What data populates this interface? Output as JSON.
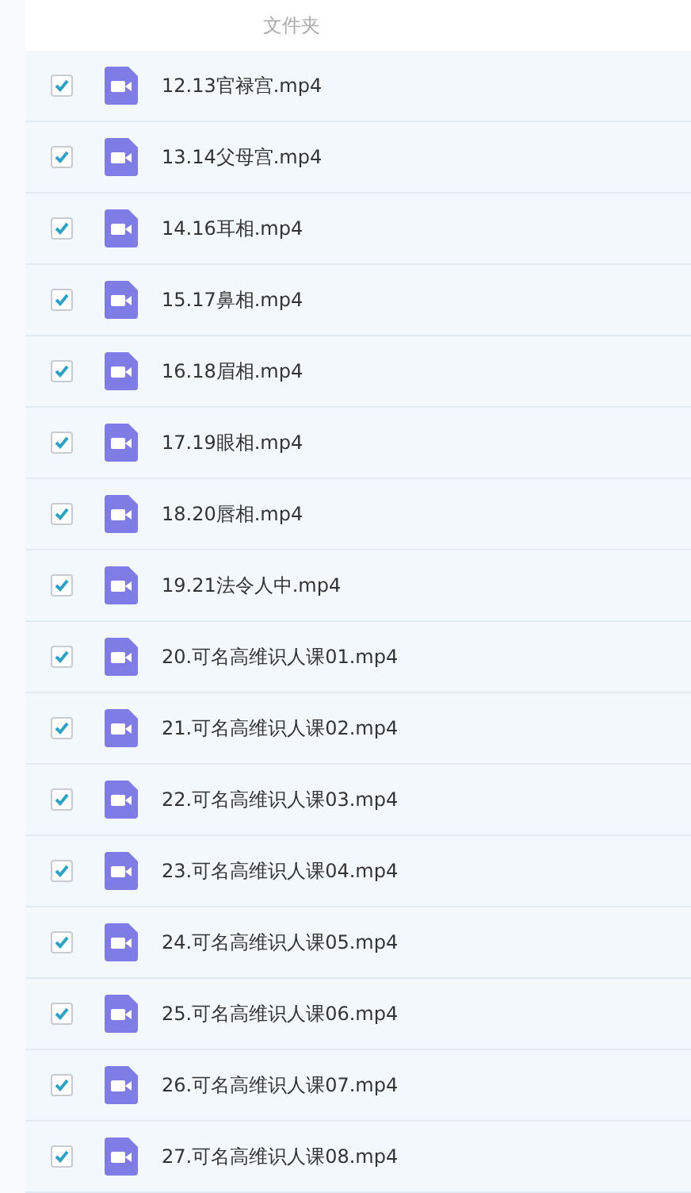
{
  "header": {
    "label": "文件夹"
  },
  "files": [
    {
      "name": "12.13官禄宫.mp4",
      "checked": true
    },
    {
      "name": "13.14父母宫.mp4",
      "checked": true
    },
    {
      "name": "14.16耳相.mp4",
      "checked": true
    },
    {
      "name": "15.17鼻相.mp4",
      "checked": true
    },
    {
      "name": "16.18眉相.mp4",
      "checked": true
    },
    {
      "name": "17.19眼相.mp4",
      "checked": true
    },
    {
      "name": "18.20唇相.mp4",
      "checked": true
    },
    {
      "name": "19.21法令人中.mp4",
      "checked": true
    },
    {
      "name": "20.可名高维识人课01.mp4",
      "checked": true
    },
    {
      "name": "21.可名高维识人课02.mp4",
      "checked": true
    },
    {
      "name": "22.可名高维识人课03.mp4",
      "checked": true
    },
    {
      "name": "23.可名高维识人课04.mp4",
      "checked": true
    },
    {
      "name": "24.可名高维识人课05.mp4",
      "checked": true
    },
    {
      "name": "25.可名高维识人课06.mp4",
      "checked": true
    },
    {
      "name": "26.可名高维识人课07.mp4",
      "checked": true
    },
    {
      "name": "27.可名高维识人课08.mp4",
      "checked": true
    }
  ]
}
